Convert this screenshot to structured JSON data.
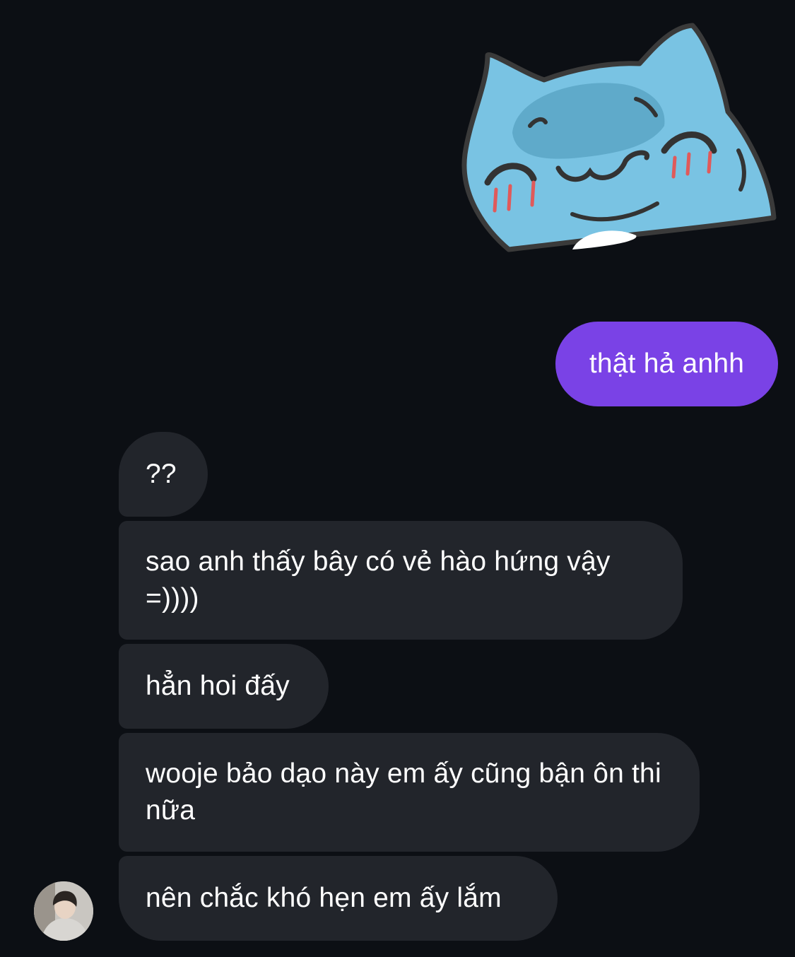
{
  "conversation": {
    "sticker": {
      "icon": "blue-cat-sticker-icon",
      "colors": {
        "body": "#79c3e3",
        "face_shade": "#5aa6c6",
        "outline": "#3a3a3a",
        "blush": "#e05a5a",
        "belly": "#ffffff"
      }
    },
    "outgoing": [
      {
        "text": "thật hả anhh"
      }
    ],
    "incoming": [
      {
        "text": "??"
      },
      {
        "text": "sao anh thấy bây có vẻ hào hứng vậy =))))"
      },
      {
        "text": "hẳn hoi đấy"
      },
      {
        "text": "wooje bảo dạo này em ấy cũng bận ôn thi nữa"
      },
      {
        "text": "nên chắc khó hẹn em ấy lắm"
      }
    ],
    "avatar": {
      "icon": "contact-avatar-icon"
    }
  },
  "colors": {
    "background": "#0c0f14",
    "outgoing_bubble": "#7a42e6",
    "incoming_bubble": "#22252b",
    "text": "#ffffff"
  }
}
